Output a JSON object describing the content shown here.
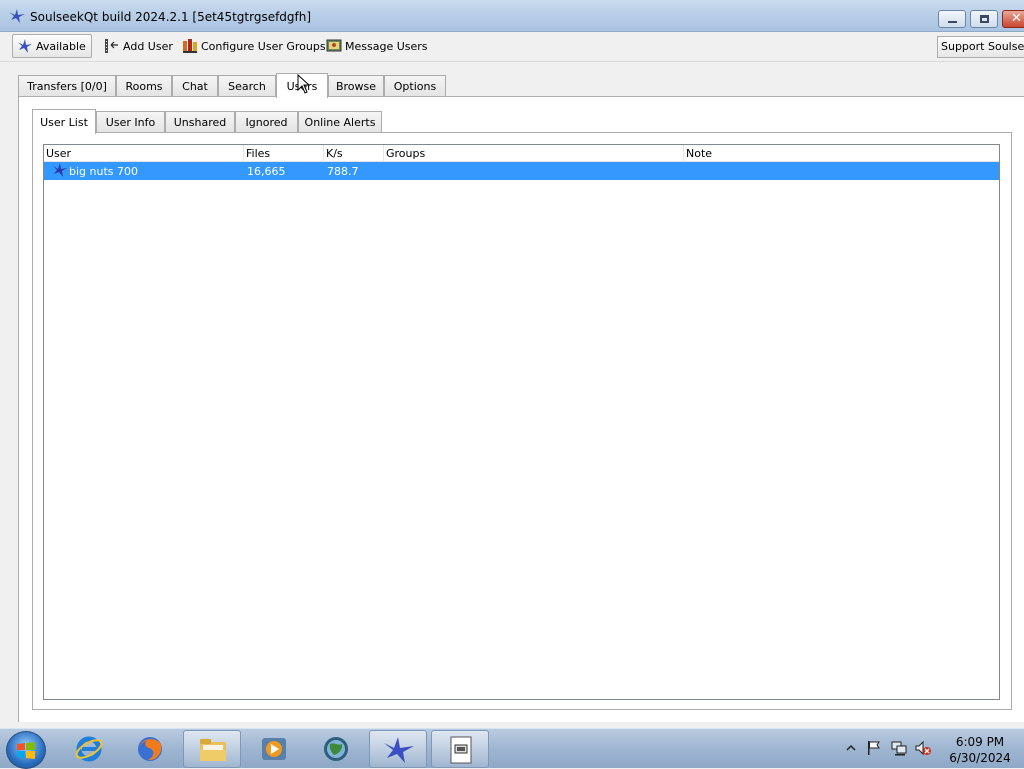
{
  "window": {
    "title": "SoulseekQt build 2024.2.1 [5et45tgtrgsefdgfh]"
  },
  "toolbar": {
    "available_label": "Available",
    "add_user_label": "Add User",
    "configure_groups_label": "Configure User Groups",
    "message_users_label": "Message Users",
    "support_label": "Support Soulseek"
  },
  "main_tabs": [
    {
      "label": "Transfers [0/0]"
    },
    {
      "label": "Rooms"
    },
    {
      "label": "Chat"
    },
    {
      "label": "Search"
    },
    {
      "label": "Users",
      "active": true
    },
    {
      "label": "Browse"
    },
    {
      "label": "Options"
    }
  ],
  "sub_tabs": [
    {
      "label": "User List",
      "active": true
    },
    {
      "label": "User Info"
    },
    {
      "label": "Unshared"
    },
    {
      "label": "Ignored"
    },
    {
      "label": "Online Alerts"
    }
  ],
  "table": {
    "columns": [
      "User",
      "Files",
      "K/s",
      "Groups",
      "Note"
    ],
    "rows": [
      {
        "user": "big nuts 700",
        "files": "16,665",
        "kbps": "788.7",
        "groups": "",
        "note": "",
        "selected": true
      }
    ]
  },
  "taskbar": {
    "items": [
      {
        "icon": "internet-explorer-icon"
      },
      {
        "icon": "firefox-icon"
      },
      {
        "icon": "file-explorer-icon"
      },
      {
        "icon": "media-player-icon"
      },
      {
        "icon": "network-globe-icon"
      },
      {
        "icon": "soulseek-icon"
      },
      {
        "icon": "document-icon"
      }
    ],
    "clock_time": "6:09 PM",
    "clock_date": "6/30/2024"
  },
  "colors": {
    "selection": "#3399ff",
    "soulseek_bird": "#3a4fc4",
    "titlebar": "#b6cde7"
  }
}
